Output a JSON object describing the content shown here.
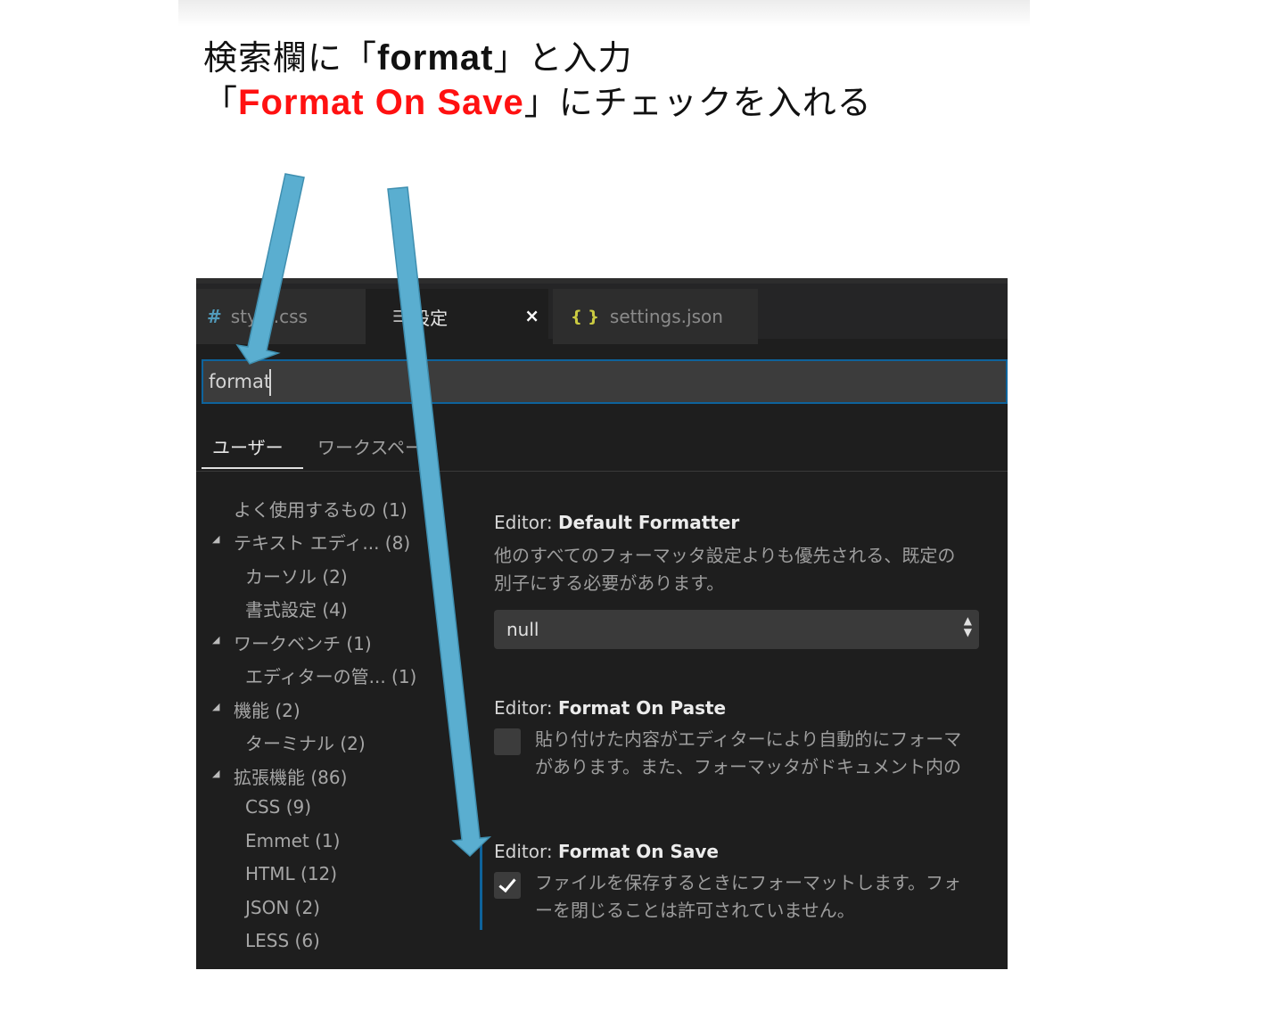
{
  "instructions": {
    "line1_pre": "検索欄に「",
    "line1_kw": "format",
    "line1_post": "」と入力",
    "line2_pre": "「",
    "line2_kw": "Format On Save",
    "line2_post": "」にチェックを入れる"
  },
  "tabs": [
    {
      "label": "style.css",
      "icon": "css-hash-icon"
    },
    {
      "label": "設定",
      "icon": "menu-icon",
      "close": "×"
    },
    {
      "label": "settings.json",
      "icon": "json-braces-icon"
    }
  ],
  "search": {
    "value": "format"
  },
  "scope_tabs": {
    "user": "ユーザー",
    "workspace": "ワークスペース"
  },
  "toc": [
    {
      "label": "よく使用するもの (1)",
      "level": 0,
      "expander": false
    },
    {
      "label": "テキスト エディ... (8)",
      "level": 0,
      "expander": true
    },
    {
      "label": "カーソル (2)",
      "level": 1,
      "expander": false
    },
    {
      "label": "書式設定 (4)",
      "level": 1,
      "expander": false
    },
    {
      "label": "ワークベンチ (1)",
      "level": 0,
      "expander": true
    },
    {
      "label": "エディターの管... (1)",
      "level": 1,
      "expander": false
    },
    {
      "label": "機能 (2)",
      "level": 0,
      "expander": true
    },
    {
      "label": "ターミナル (2)",
      "level": 1,
      "expander": false
    },
    {
      "label": "拡張機能 (86)",
      "level": 0,
      "expander": true
    },
    {
      "label": "CSS (9)",
      "level": 1,
      "expander": false
    },
    {
      "label": "Emmet (1)",
      "level": 1,
      "expander": false
    },
    {
      "label": "HTML (12)",
      "level": 1,
      "expander": false
    },
    {
      "label": "JSON (2)",
      "level": 1,
      "expander": false
    },
    {
      "label": "LESS (6)",
      "level": 1,
      "expander": false
    }
  ],
  "settings": {
    "default_formatter": {
      "category": "Editor: ",
      "name": "Default Formatter",
      "desc1": "他のすべてのフォーマッタ設定よりも優先される、既定の",
      "desc2": "別子にする必要があります。",
      "value": "null"
    },
    "format_on_paste": {
      "category": "Editor: ",
      "name": "Format On Paste",
      "desc1": "貼り付けた内容がエディターにより自動的にフォーマ",
      "desc2": "があります。また、フォーマッタがドキュメント内の",
      "checked": false
    },
    "format_on_save": {
      "category": "Editor: ",
      "name": "Format On Save",
      "desc1": "ファイルを保存するときにフォーマットします。フォ",
      "desc2": "ーを閉じることは許可されていません。",
      "checked": true
    }
  },
  "colors": {
    "highlight_red": "#ff1111",
    "arrow_blue": "#5aaed0",
    "focus_border": "#0e639c"
  }
}
